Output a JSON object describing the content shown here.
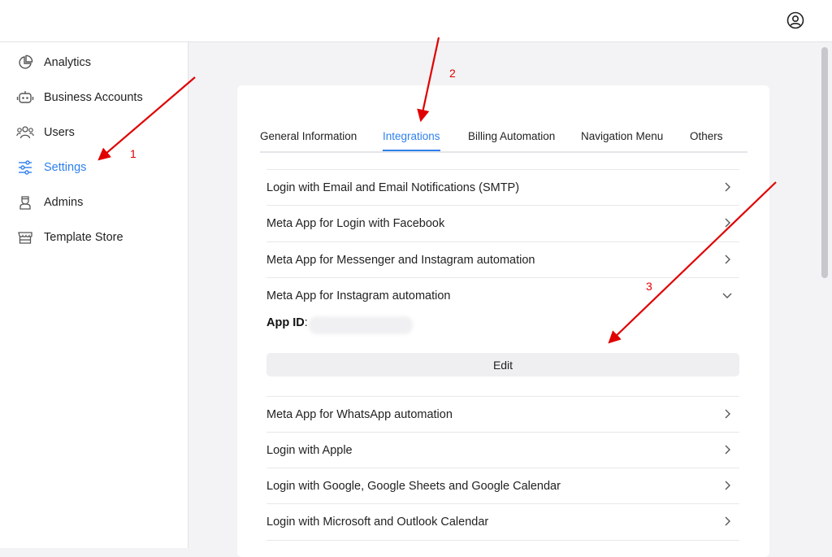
{
  "header": {
    "profile_icon": "user-circle-icon"
  },
  "sidebar": {
    "items": [
      {
        "label": "Analytics",
        "icon": "pie-chart-icon"
      },
      {
        "label": "Business Accounts",
        "icon": "robot-icon"
      },
      {
        "label": "Users",
        "icon": "users-icon"
      },
      {
        "label": "Settings",
        "icon": "sliders-icon",
        "active": true
      },
      {
        "label": "Admins",
        "icon": "admin-icon"
      },
      {
        "label": "Template Store",
        "icon": "store-icon"
      }
    ]
  },
  "tabs": [
    {
      "label": "General Information"
    },
    {
      "label": "Integrations",
      "active": true
    },
    {
      "label": "Billing Automation"
    },
    {
      "label": "Navigation Menu"
    },
    {
      "label": "Others"
    }
  ],
  "integrations": [
    {
      "label": "Login with Email and Email Notifications (SMTP)",
      "expanded": false
    },
    {
      "label": "Meta App for Login with Facebook",
      "expanded": false
    },
    {
      "label": "Meta App for Messenger and Instagram automation",
      "expanded": false
    },
    {
      "label": "Meta App for Instagram automation",
      "expanded": true
    },
    {
      "label": "Meta App for WhatsApp automation",
      "expanded": false
    },
    {
      "label": "Login with Apple",
      "expanded": false
    },
    {
      "label": "Login with Google, Google Sheets and Google Calendar",
      "expanded": false
    },
    {
      "label": "Login with Microsoft and Outlook Calendar",
      "expanded": false
    }
  ],
  "expanded_panel": {
    "app_id_label": "App ID",
    "app_id_colon": ":",
    "edit_label": "Edit"
  },
  "annotations": {
    "step1": "1",
    "step2": "2",
    "step3": "3"
  },
  "colors": {
    "accent": "#2f80ed",
    "annotation": "#e00000"
  }
}
